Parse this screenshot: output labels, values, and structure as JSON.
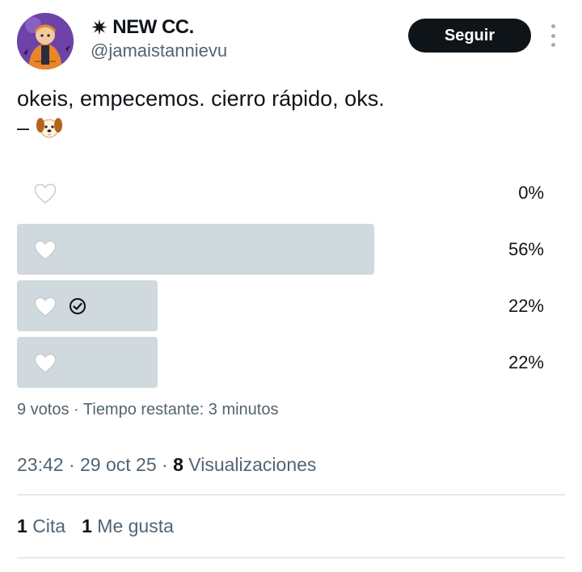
{
  "author": {
    "display_name": "NEW CC.",
    "name_prefix_icon": "asterisk-star-icon",
    "handle": "@jamaistannievu",
    "avatar_icon": "pumpkin-costume-avatar-icon"
  },
  "follow_button": {
    "label": "Seguir"
  },
  "more_menu_icon": "vertical-ellipsis-icon",
  "tweet": {
    "line1": "okeis, empecemos. cierro rápido, oks.",
    "line2_prefix": "–",
    "line2_emoji_icon": "dog-face-icon"
  },
  "poll": {
    "options": [
      {
        "icon": "white-heart-icon",
        "percent": "0%",
        "fraction": 0.0,
        "voted": false
      },
      {
        "icon": "white-heart-icon",
        "percent": "56%",
        "fraction": 0.56,
        "voted": false
      },
      {
        "icon": "white-heart-icon",
        "percent": "22%",
        "fraction": 0.22,
        "voted": true
      },
      {
        "icon": "white-heart-icon",
        "percent": "22%",
        "fraction": 0.22,
        "voted": false
      }
    ],
    "meta": "9 votos · Tiempo restante: 3 minutos"
  },
  "timestamp": {
    "time": "23:42",
    "date": "29 oct 25",
    "views_count": "8",
    "views_label": "Visualizaciones"
  },
  "stats": {
    "quotes_count": "1",
    "quotes_label": "Cita",
    "likes_count": "1",
    "likes_label": "Me gusta"
  },
  "colors": {
    "text": "#0f1419",
    "muted": "#536471",
    "poll_fill": "#cfd9de",
    "button_bg": "#0f1419"
  }
}
